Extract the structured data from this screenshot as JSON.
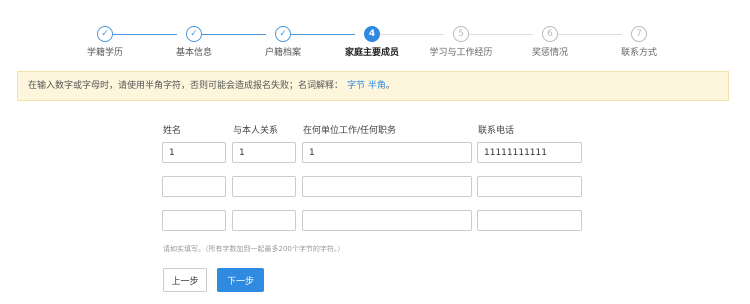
{
  "steps": [
    {
      "label": "学籍学历",
      "state": "done",
      "icon": "check-icon",
      "mark": "✓"
    },
    {
      "label": "基本信息",
      "state": "done",
      "icon": "check-icon",
      "mark": "✓"
    },
    {
      "label": "户籍档案",
      "state": "done",
      "icon": "check-icon",
      "mark": "✓"
    },
    {
      "label": "家庭主要成员",
      "state": "active",
      "number": "4"
    },
    {
      "label": "学习与工作经历",
      "state": "future",
      "number": "5"
    },
    {
      "label": "奖惩情况",
      "state": "future",
      "number": "6"
    },
    {
      "label": "联系方式",
      "state": "future",
      "number": "7"
    }
  ],
  "notice": {
    "text": "在输入数字或字母时，请使用半角字符，否则可能会造成报名失败；名词解释：",
    "links": "字节 半角",
    "end": "。"
  },
  "table": {
    "headers": [
      "姓名",
      "与本人关系",
      "在何单位工作/任何职务",
      "联系电话"
    ],
    "rows": [
      [
        "1",
        "1",
        "1",
        "11111111111"
      ],
      [
        "",
        "",
        "",
        ""
      ],
      [
        "",
        "",
        "",
        ""
      ]
    ]
  },
  "hint": "请如实填写。（所有字数加到一起最多200个字节的字符。）",
  "buttons": {
    "prev": "上一步",
    "next": "下一步"
  },
  "colors": {
    "accent": "#2f8ae0",
    "notice_bg": "#fdf6dd"
  }
}
